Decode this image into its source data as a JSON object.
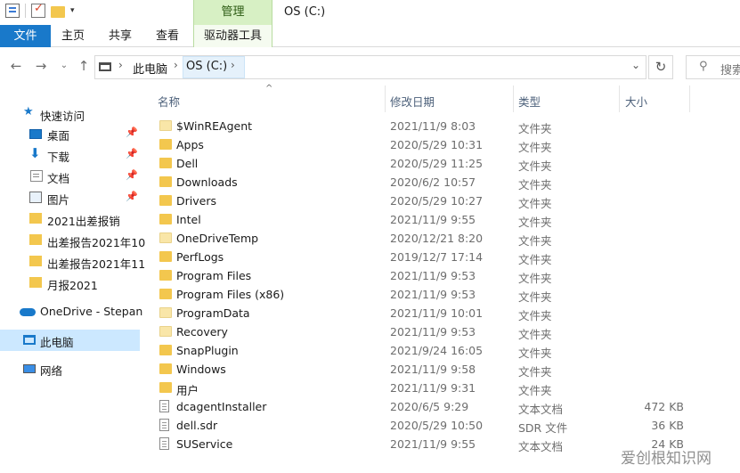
{
  "window": {
    "title": "OS (C:)",
    "context_tab": "管理"
  },
  "ribbon": {
    "tabs": [
      "文件",
      "主页",
      "共享",
      "查看",
      "驱动器工具"
    ]
  },
  "address": {
    "crumbs": [
      "此电脑",
      "OS (C:)"
    ],
    "search_placeholder": "搜索"
  },
  "nav": {
    "quick_access": "快速访问",
    "items": [
      {
        "label": "桌面",
        "icon": "desktop-icon",
        "pinned": true
      },
      {
        "label": "下载",
        "icon": "download-icon",
        "pinned": true
      },
      {
        "label": "文档",
        "icon": "document-icon",
        "pinned": true
      },
      {
        "label": "图片",
        "icon": "picture-icon",
        "pinned": true
      },
      {
        "label": "2021出差报销",
        "icon": "folder-icon",
        "pinned": false
      },
      {
        "label": "出差报告2021年10",
        "icon": "folder-icon",
        "pinned": false
      },
      {
        "label": "出差报告2021年11",
        "icon": "folder-icon",
        "pinned": false
      },
      {
        "label": "月报2021",
        "icon": "folder-icon",
        "pinned": false
      }
    ],
    "onedrive": "OneDrive - Stepan",
    "this_pc": "此电脑",
    "network": "网络"
  },
  "columns": {
    "name": "名称",
    "date": "修改日期",
    "type": "类型",
    "size": "大小"
  },
  "files": [
    {
      "name": "$WinREAgent",
      "date": "2021/11/9 8:03",
      "type": "文件夹",
      "size": "",
      "kind": "folder-light"
    },
    {
      "name": "Apps",
      "date": "2020/5/29 10:31",
      "type": "文件夹",
      "size": "",
      "kind": "folder"
    },
    {
      "name": "Dell",
      "date": "2020/5/29 11:25",
      "type": "文件夹",
      "size": "",
      "kind": "folder"
    },
    {
      "name": "Downloads",
      "date": "2020/6/2 10:57",
      "type": "文件夹",
      "size": "",
      "kind": "folder"
    },
    {
      "name": "Drivers",
      "date": "2020/5/29 10:27",
      "type": "文件夹",
      "size": "",
      "kind": "folder"
    },
    {
      "name": "Intel",
      "date": "2021/11/9 9:55",
      "type": "文件夹",
      "size": "",
      "kind": "folder"
    },
    {
      "name": "OneDriveTemp",
      "date": "2020/12/21 8:20",
      "type": "文件夹",
      "size": "",
      "kind": "folder-light"
    },
    {
      "name": "PerfLogs",
      "date": "2019/12/7 17:14",
      "type": "文件夹",
      "size": "",
      "kind": "folder"
    },
    {
      "name": "Program Files",
      "date": "2021/11/9 9:53",
      "type": "文件夹",
      "size": "",
      "kind": "folder"
    },
    {
      "name": "Program Files (x86)",
      "date": "2021/11/9 9:53",
      "type": "文件夹",
      "size": "",
      "kind": "folder"
    },
    {
      "name": "ProgramData",
      "date": "2021/11/9 10:01",
      "type": "文件夹",
      "size": "",
      "kind": "folder-light"
    },
    {
      "name": "Recovery",
      "date": "2021/11/9 9:53",
      "type": "文件夹",
      "size": "",
      "kind": "folder-light"
    },
    {
      "name": "SnapPlugin",
      "date": "2021/9/24 16:05",
      "type": "文件夹",
      "size": "",
      "kind": "folder"
    },
    {
      "name": "Windows",
      "date": "2021/11/9 9:58",
      "type": "文件夹",
      "size": "",
      "kind": "folder"
    },
    {
      "name": "用户",
      "date": "2021/11/9 9:31",
      "type": "文件夹",
      "size": "",
      "kind": "folder"
    },
    {
      "name": "dcagentInstaller",
      "date": "2020/6/5 9:29",
      "type": "文本文档",
      "size": "472 KB",
      "kind": "file"
    },
    {
      "name": "dell.sdr",
      "date": "2020/5/29 10:50",
      "type": "SDR 文件",
      "size": "36 KB",
      "kind": "file"
    },
    {
      "name": "SUService",
      "date": "2021/11/9 9:55",
      "type": "文本文档",
      "size": "24 KB",
      "kind": "file"
    }
  ],
  "watermark": "爱创根知识网"
}
